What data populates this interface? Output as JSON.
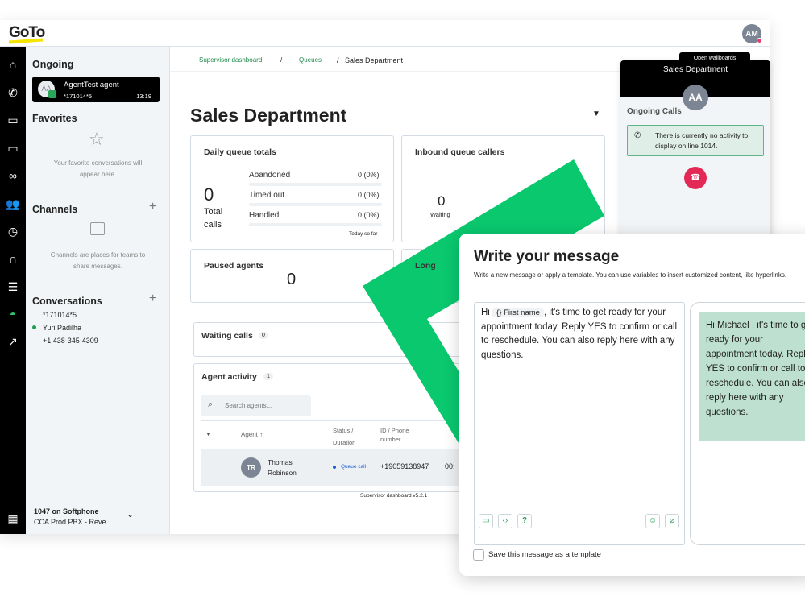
{
  "header": {
    "logo": "GoTo",
    "user_initials": "AM"
  },
  "rail": {
    "icons": [
      "home-icon",
      "phone-icon",
      "chat-icon",
      "video-icon",
      "voicemail-icon",
      "contacts-icon",
      "history-icon",
      "headset-icon",
      "settings-sliders-icon",
      "dashboard-icon",
      "analytics-icon"
    ],
    "apps_icon": "grid-icon"
  },
  "sidebar": {
    "ongoing_title": "Ongoing",
    "ongoing_call": {
      "initials": "AA",
      "name": "AgentTest agent",
      "number": "*171014*5",
      "duration": "13:19"
    },
    "favorites_title": "Favorites",
    "favorites_empty": "Your favorite conversations will appear here.",
    "channels_title": "Channels",
    "channels_empty": "Channels are places for teams to share messages.",
    "conversations_title": "Conversations",
    "conversations": [
      "*171014*5",
      "Yuri Padilha",
      "+1 438-345-4309"
    ],
    "line_title": "1047 on Softphone",
    "line_sub": "CCA Prod PBX - Reve..."
  },
  "main": {
    "breadcrumb": [
      "Supervisor dashboard",
      "Queues",
      "Sales Department"
    ],
    "title": "Sales Department",
    "daily": {
      "title": "Daily queue totals",
      "total": "0",
      "total_label": "Total calls",
      "rows": [
        {
          "label": "Abandoned",
          "value": "0 (0%)"
        },
        {
          "label": "Timed out",
          "value": "0 (0%)"
        },
        {
          "label": "Handled",
          "value": "0 (0%)"
        }
      ],
      "footer": "Today so far"
    },
    "inbound": {
      "title": "Inbound queue callers",
      "waiting": "0",
      "waiting_label": "Waiting",
      "other": "0"
    },
    "paused": {
      "title": "Paused agents",
      "value": "0"
    },
    "longest": {
      "title": "Long"
    },
    "waiting_calls": {
      "title": "Waiting calls",
      "count": "0"
    },
    "agent_activity": {
      "title": "Agent activity",
      "count": "1",
      "search_placeholder": "Search agents...",
      "columns": [
        "Agent",
        "Status / Duration",
        "ID / Phone number"
      ],
      "rows": [
        {
          "initials": "TR",
          "name": "Thomas Robinson",
          "status": "Queue call",
          "phone": "+19059138947",
          "duration": "00:"
        }
      ]
    },
    "version": "Supervisor dashboard v5.2.1"
  },
  "right_panel": {
    "button": "Open wallboards",
    "title": "Sales Department",
    "initials": "AA",
    "section": "Ongoing Calls",
    "notice": "There is currently no activity to display on line 1014."
  },
  "message": {
    "title": "Write your message",
    "subtitle": "Write a new message or apply a template. You can use variables to insert customized content, like hyperlinks.",
    "hi": "Hi",
    "variable": "{} First name",
    "body": ", it's time to get ready for your appointment today. Reply YES to confirm or call to reschedule. You can also reply here with any questions.",
    "preview": "Hi Michael  , it's time to get ready for your appointment today. Reply YES to confirm or call to reschedule. You can also reply here with any questions.",
    "save_template": "Save this message as a template",
    "save_checked": false
  },
  "colors": {
    "accent": "#0ac86e",
    "brand_link": "#1f8a4c",
    "hangup": "#e32a57",
    "preview_bg": "#bde0d0"
  }
}
